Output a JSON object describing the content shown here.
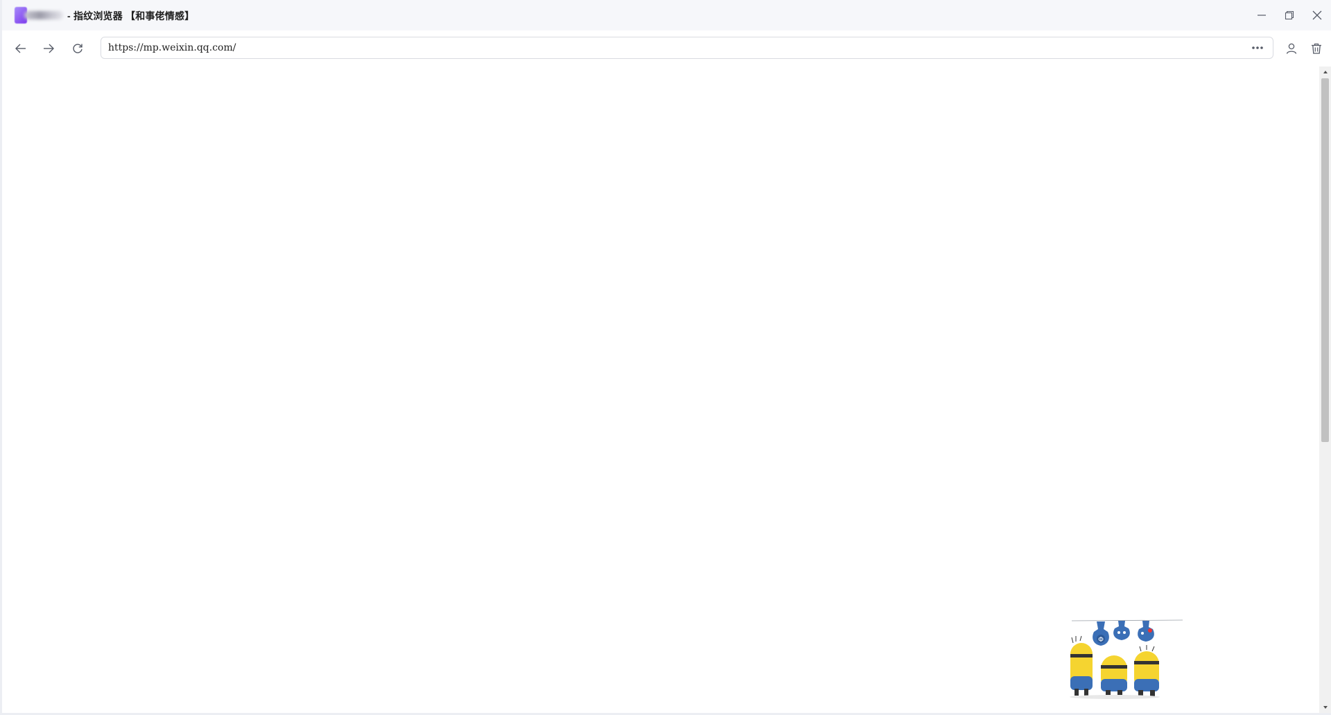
{
  "window": {
    "title": "- 指纹浏览器 【和事佬情感】"
  },
  "window_controls": {
    "minimize": "minimize-icon",
    "restore": "restore-icon",
    "close": "close-icon"
  },
  "toolbar": {
    "back_icon": "arrow-left-icon",
    "forward_icon": "arrow-right-icon",
    "reload_icon": "reload-icon",
    "url": "https://mp.weixin.qq.com/",
    "more_icon": "more-horizontal-icon",
    "profile_icon": "user-icon",
    "trash_icon": "trash-icon"
  },
  "colors": {
    "titlebar_bg": "#f6f7fa",
    "url_border": "#d9dbe1",
    "icon": "#555a66",
    "accent": "#7c3aed",
    "minion_yellow": "#f5d430",
    "overalls_blue": "#3b6fb6"
  }
}
